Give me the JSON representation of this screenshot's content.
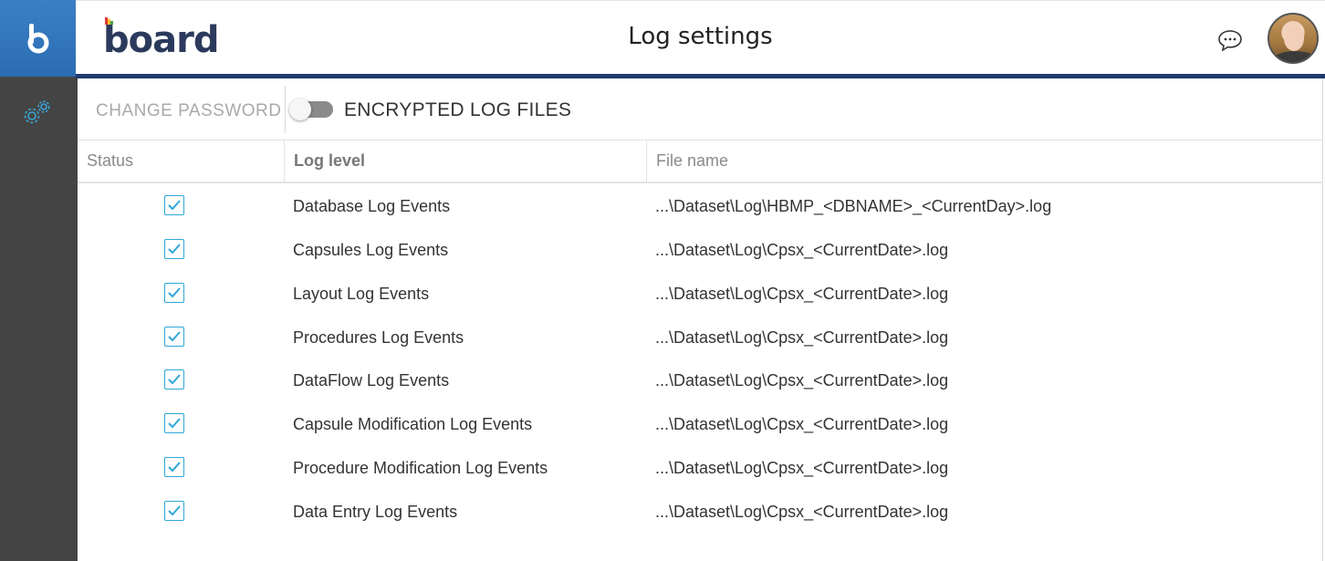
{
  "header": {
    "logo_text": "board",
    "title": "Log settings",
    "chat_icon": "chat-bubble-icon",
    "avatar_icon": "user-avatar"
  },
  "sidebar": {
    "app_icon": "board-b-icon",
    "items": [
      {
        "icon": "settings-gears-icon"
      }
    ]
  },
  "toolbar": {
    "change_password_label": "CHANGE PASSWORD",
    "encrypted_toggle_label": "ENCRYPTED LOG FILES",
    "encrypted_toggle_on": false
  },
  "table": {
    "columns": [
      "Status",
      "Log level",
      "File name"
    ],
    "rows": [
      {
        "checked": true,
        "level": "Database Log Events",
        "file": "...\\Dataset\\Log\\HBMP_<DBNAME>_<CurrentDay>.log"
      },
      {
        "checked": true,
        "level": "Capsules Log Events",
        "file": "...\\Dataset\\Log\\Cpsx_<CurrentDate>.log"
      },
      {
        "checked": true,
        "level": "Layout Log Events",
        "file": "...\\Dataset\\Log\\Cpsx_<CurrentDate>.log"
      },
      {
        "checked": true,
        "level": "Procedures Log Events",
        "file": "...\\Dataset\\Log\\Cpsx_<CurrentDate>.log"
      },
      {
        "checked": true,
        "level": "DataFlow Log Events",
        "file": "...\\Dataset\\Log\\Cpsx_<CurrentDate>.log"
      },
      {
        "checked": true,
        "level": "Capsule Modification Log Events",
        "file": "...\\Dataset\\Log\\Cpsx_<CurrentDate>.log"
      },
      {
        "checked": true,
        "level": "Procedure Modification Log Events",
        "file": "...\\Dataset\\Log\\Cpsx_<CurrentDate>.log"
      },
      {
        "checked": true,
        "level": "Data Entry Log Events",
        "file": "...\\Dataset\\Log\\Cpsx_<CurrentDate>.log"
      }
    ]
  },
  "colors": {
    "brand_blue": "#2a6db3",
    "header_rule": "#1f3a6e",
    "sidebar_bg": "#444444",
    "checkbox_accent": "#2fa7d8",
    "gear_icon": "#3aa6d6"
  }
}
